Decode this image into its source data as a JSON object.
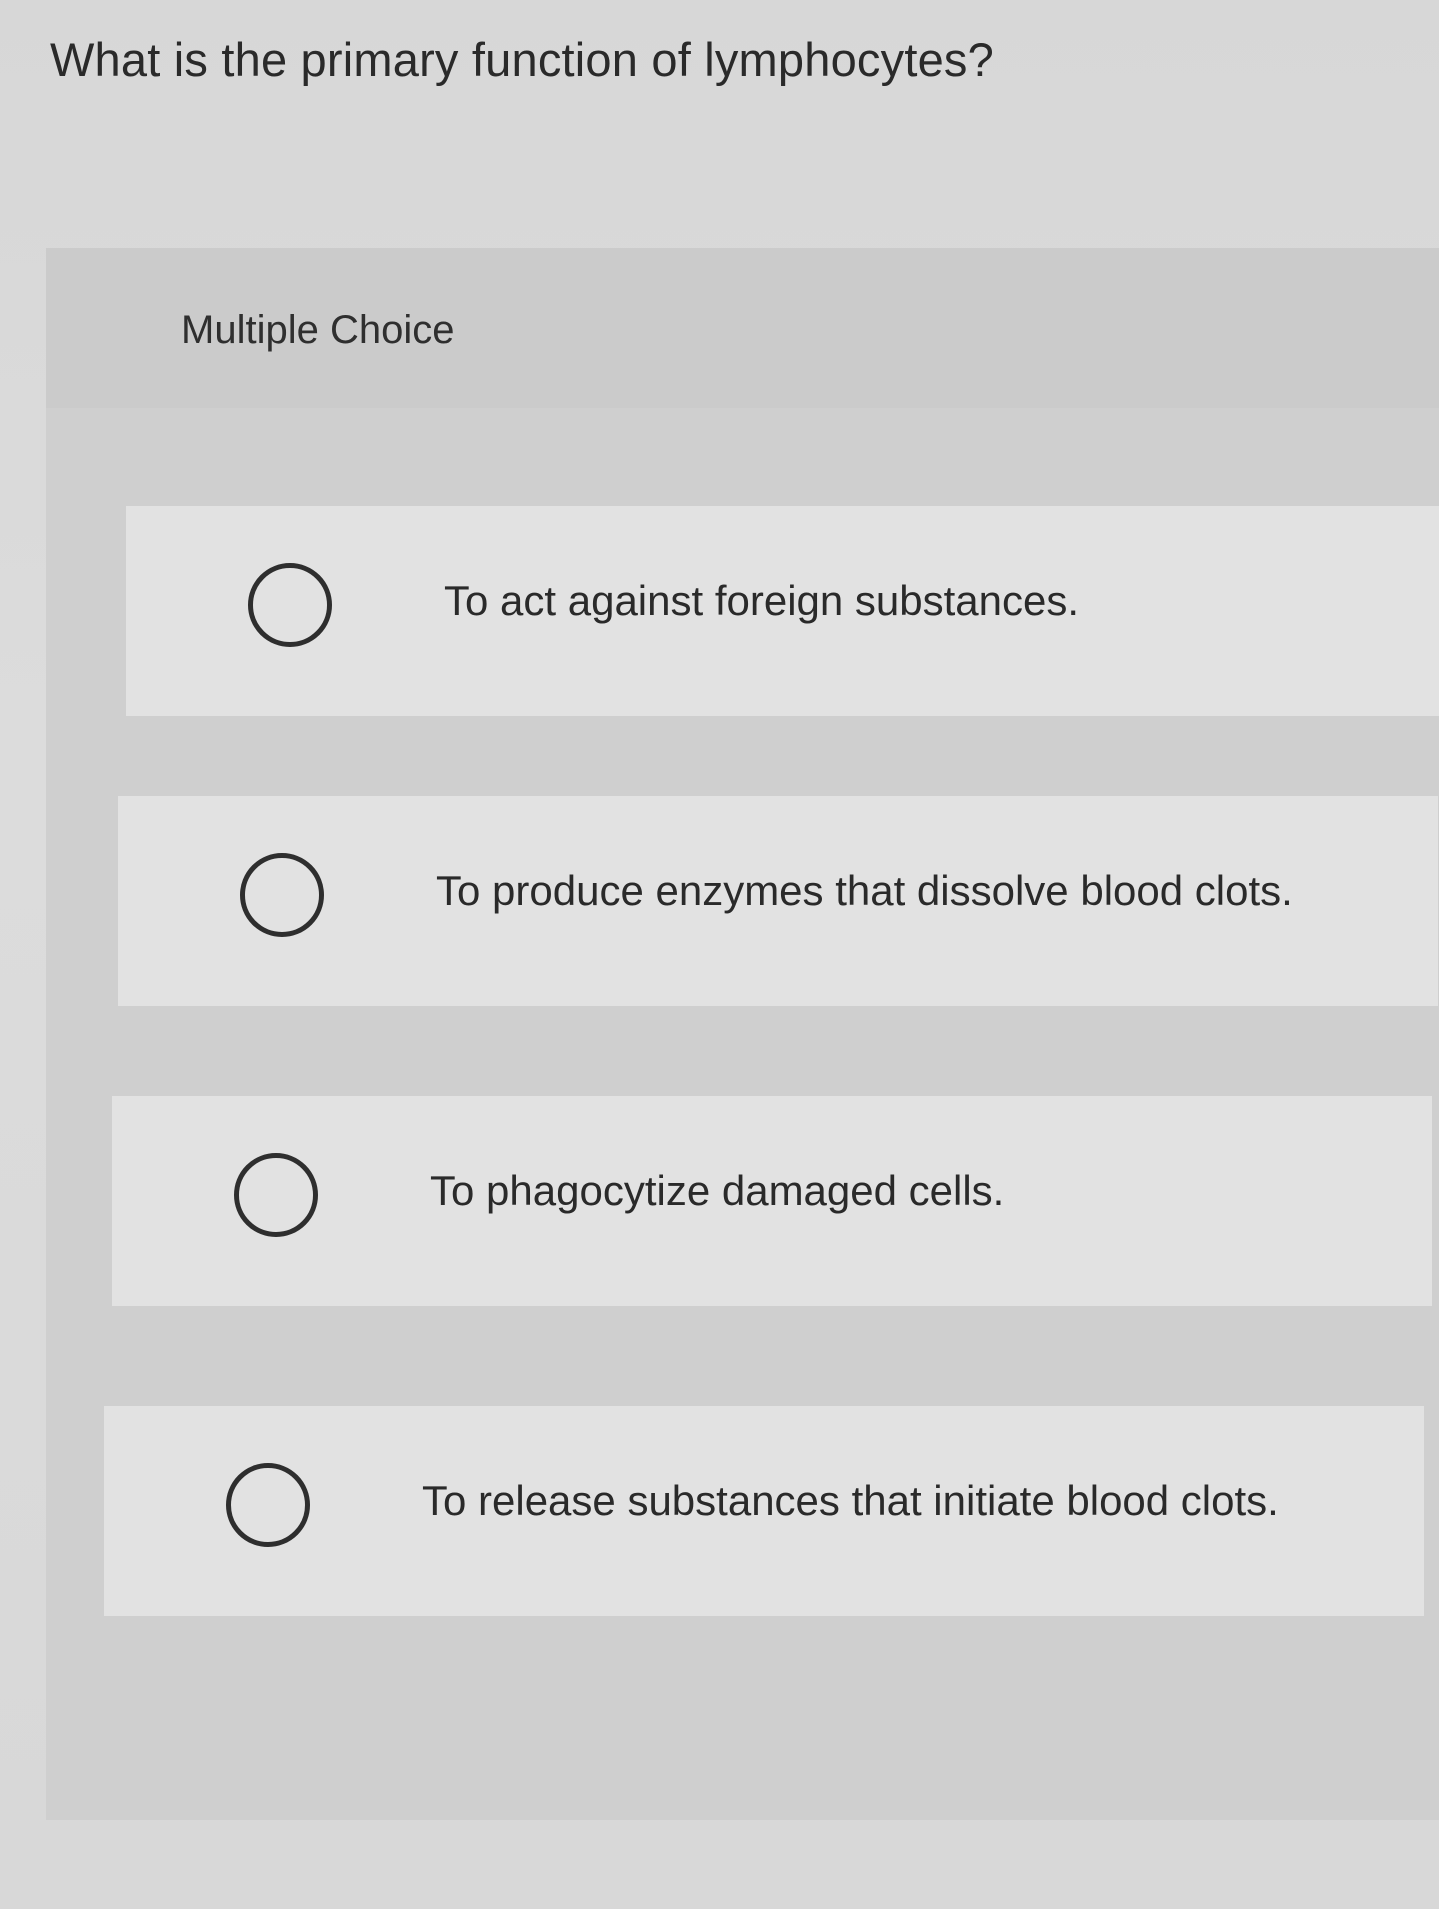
{
  "question": {
    "title": "What is the primary function of lymphocytes?"
  },
  "panel": {
    "label": "Multiple Choice"
  },
  "choices": [
    {
      "text": "To act against foreign substances."
    },
    {
      "text": "To produce enzymes that dissolve blood clots."
    },
    {
      "text": "To phagocytize damaged cells."
    },
    {
      "text": "To release substances that initiate blood clots."
    }
  ]
}
